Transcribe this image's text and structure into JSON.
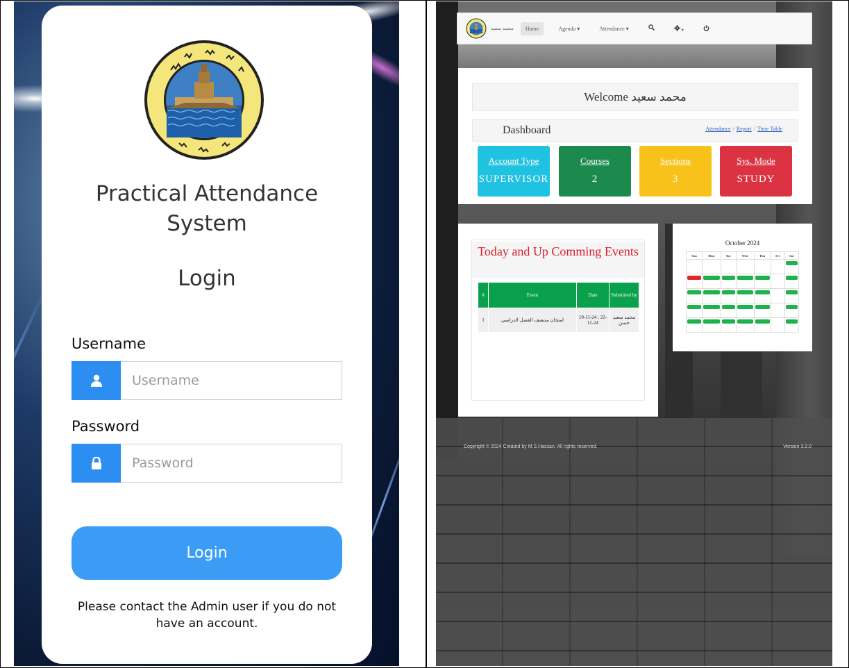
{
  "login": {
    "logo_alt": "قسم الفيزياء - كلية العلوم جامعة الاسكندرية",
    "app_title_line1": "Practical Attendance",
    "app_title_line2": "System",
    "heading": "Login",
    "username_label": "Username",
    "username_placeholder": "Username",
    "password_label": "Password",
    "password_placeholder": "Password",
    "login_button": "Login",
    "contact_note": "Please contact the Admin user if you do not have an account.",
    "accent_color": "#2b8ef0",
    "icons": {
      "username": "user-icon",
      "password": "lock-icon"
    }
  },
  "dashboard": {
    "navbar": {
      "brand": "محمد سعيد",
      "items": [
        {
          "label": "Home",
          "active": true
        },
        {
          "label": "Agenda ▾"
        },
        {
          "label": "Attendance ▾"
        }
      ],
      "icons": [
        "search-icon",
        "gear-icon",
        "power-icon"
      ]
    },
    "welcome": "Welcome محمد سعيد",
    "dashboard_title": "Dashboard",
    "breadcrumbs": [
      "Attendance",
      "Report",
      "Time Table"
    ],
    "tiles": [
      {
        "label": "Account Type",
        "value": "SUPERVISOR",
        "color": "#1fc2e0"
      },
      {
        "label": "Courses",
        "value": "2",
        "color": "#1c8a4c"
      },
      {
        "label": "Sections",
        "value": "3",
        "color": "#f8c21b"
      },
      {
        "label": "Sys. Mode",
        "value": "STUDY",
        "color": "#db3342"
      }
    ],
    "events": {
      "title": "Today and Up Comming Events",
      "headers": [
        "#",
        "Event",
        "Date",
        "Submitted by"
      ],
      "rows": [
        {
          "num": "1",
          "event": "امتحان منتصف الفصل الدراسي",
          "date": "10-11-24 : 22-11-24",
          "by": "محمد سعيد حسن"
        }
      ]
    },
    "calendar": {
      "title": "October 2024",
      "weekdays": [
        "Sun",
        "Mon",
        "Tue",
        "Wed",
        "Thu",
        "Fri",
        "Sat"
      ]
    },
    "footer": {
      "copyright": "Copyright © 2024 Created by M.S.Hassan. All rights reserved.",
      "version": "Version 3.2.0"
    }
  }
}
